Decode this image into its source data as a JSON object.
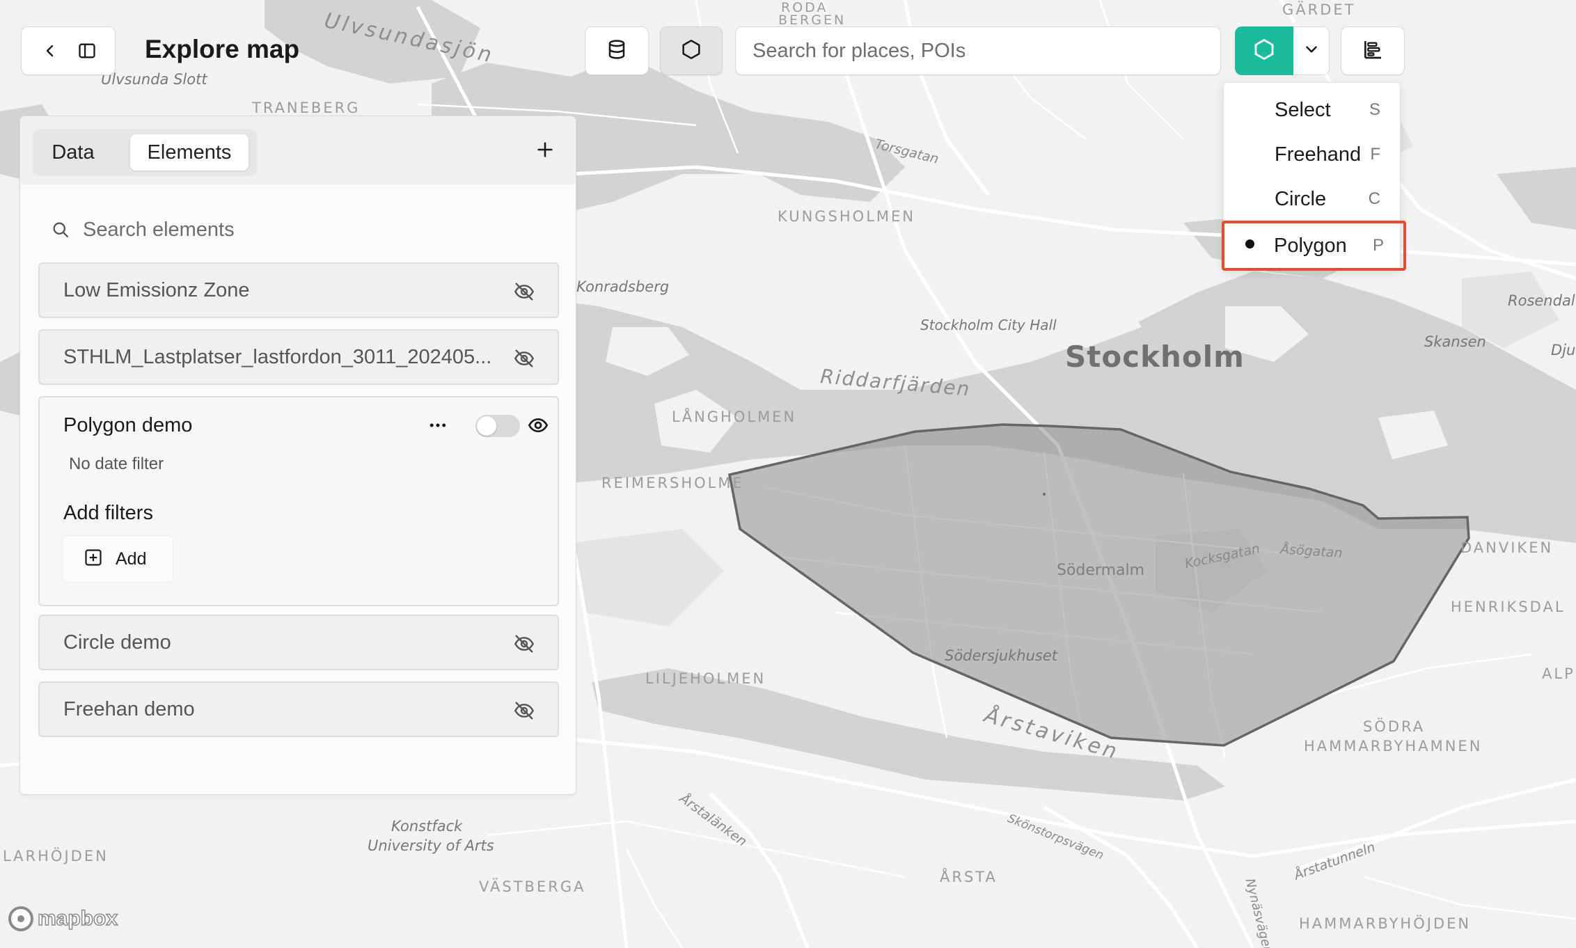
{
  "header": {
    "back_icon": "chevron-left-icon",
    "sidebar_icon": "sidebar-toggle-icon",
    "title": "Explore map"
  },
  "toolbar": {
    "data_icon": "database-icon",
    "shape_icon": "hexagon-icon",
    "search_placeholder": "Search for places, POIs",
    "draw_icon": "hexagon-icon",
    "caret_icon": "chevron-down-icon",
    "legend_icon": "legend-icon",
    "accent_color": "#1abc9c"
  },
  "draw_menu": {
    "items": [
      {
        "label": "Select",
        "key": "S"
      },
      {
        "label": "Freehand",
        "key": "F"
      },
      {
        "label": "Circle",
        "key": "C"
      },
      {
        "label": "Polygon",
        "key": "P",
        "selected": true
      }
    ],
    "highlight_color": "#ea4c2b"
  },
  "panel": {
    "tabs": [
      {
        "label": "Data",
        "active": false
      },
      {
        "label": "Elements",
        "active": true
      }
    ],
    "add_icon": "plus-icon",
    "search_placeholder": "Search elements",
    "elements": [
      {
        "name": "Low Emissionz Zone",
        "visible": false
      },
      {
        "name": "STHLM_Lastplatser_lastfordon_3011_202405...",
        "visible": false
      },
      {
        "name": "Circle demo",
        "visible": false
      },
      {
        "name": "Freehan demo",
        "visible": false
      }
    ],
    "expanded": {
      "name": "Polygon demo",
      "date_filter": "No date filter",
      "filters_heading": "Add filters",
      "add_label": "Add",
      "toggle_on": false,
      "visible": true
    }
  },
  "map": {
    "districts": [
      "TRANEBERG",
      "KUNGSHOLMEN",
      "LÅNGHOLMEN",
      "REIMERSHOLME",
      "LILJEHOLMEN",
      "VÄSTBERGA",
      "ÅRSTA",
      "HENRIKSDAL",
      "SÖDRA",
      "HAMMARBYHAMNEN",
      "HAMMARBYHÖJDEN",
      "DANVIKEN",
      "GÄRDET",
      "LARHÖJDEN",
      "ALP",
      "RODA",
      "BERGEN"
    ],
    "water": [
      "Ulvsundasjön",
      "Riddarfjärden",
      "Årstaviken"
    ],
    "streets": [
      "Torsgatan",
      "Kocksgatan",
      "Åsögatan",
      "Årstalänken",
      "Skönstorpsvägen",
      "Årstatunneln",
      "Nynäsvägen"
    ],
    "places": [
      "Ulvsunda Slott",
      "Konradsberg",
      "Stockholm City Hall",
      "Södermalm",
      "Södersjukhuset",
      "Konstfack",
      "University of Arts",
      "Rosendal",
      "Skansen",
      "Djur"
    ],
    "city": "Stockholm",
    "attribution": "mapbox",
    "polygon_fill": "#8f8f8f",
    "polygon_stroke": "#666666"
  }
}
